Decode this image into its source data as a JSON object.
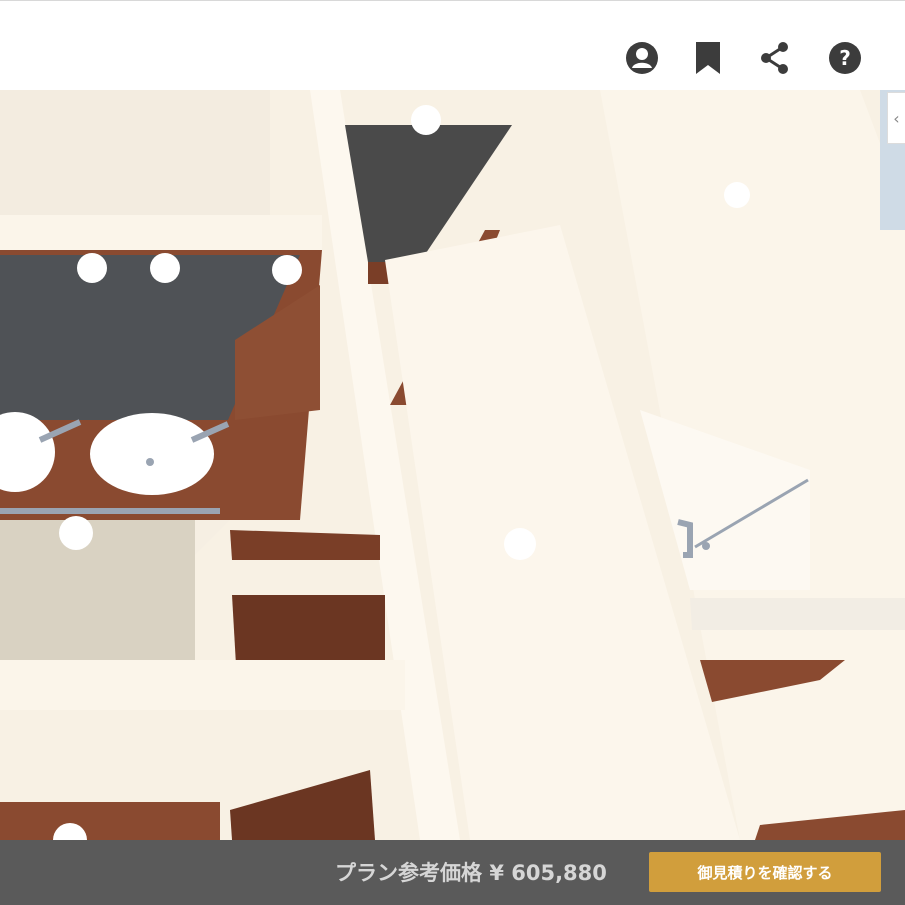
{
  "header": {
    "icons": [
      {
        "name": "account-icon"
      },
      {
        "name": "bookmark-icon"
      },
      {
        "name": "share-icon"
      },
      {
        "name": "help-icon",
        "glyph": "?"
      }
    ]
  },
  "viewport": {
    "colors": {
      "wall": "#fbf3e6",
      "floor_wood": "#8a4a30",
      "dark_counter": "#4f5256",
      "concrete": "#d9d2c2",
      "sink": "#ffffff",
      "faucet": "#9aa4b2"
    }
  },
  "side_panel": {
    "toggle_glyph": "‹"
  },
  "footer": {
    "price_label": "プラン参考価格",
    "price_value": "¥ 605,880",
    "estimate_button": "御見積りを確認する"
  },
  "colors": {
    "footer_bg": "#5a5a5a",
    "button_bg": "#d19e3c",
    "icon": "#3c3c3c"
  }
}
